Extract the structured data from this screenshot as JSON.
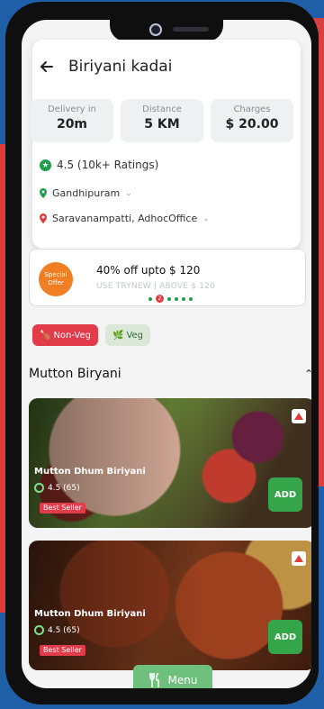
{
  "restaurant": {
    "name": "Biriyani kadai",
    "rating_text": "4.5 (10k+ Ratings)",
    "location_from": "Gandhipuram",
    "location_to": "Saravanampatti, AdhocOffice"
  },
  "stats": [
    {
      "label": "Delivery in",
      "value": "20m"
    },
    {
      "label": "Distance",
      "value": "5 KM"
    },
    {
      "label": "Charges",
      "value": "$ 20.00"
    }
  ],
  "offer": {
    "badge": "Special Offer",
    "title": "40% off upto $ 120",
    "subtitle": "USE TRYNEW | ABOVE $ 120",
    "page_indicator": "2"
  },
  "filters": {
    "nonveg": "Non-Veg",
    "veg": "Veg"
  },
  "section": {
    "title": "Mutton Biryani"
  },
  "items": [
    {
      "name": "Mutton Dhum Biriyani",
      "rating": "4.5 (65)",
      "tag": "Best Seller",
      "add": "ADD"
    },
    {
      "name": "Mutton Dhum Biriyani",
      "rating": "4.5 (65)",
      "tag": "Best Seller",
      "add": "ADD"
    }
  ],
  "menu_button": "Menu",
  "colors": {
    "accent_green": "#35a54a",
    "accent_red": "#e23b4a",
    "offer_orange": "#f07e22"
  }
}
